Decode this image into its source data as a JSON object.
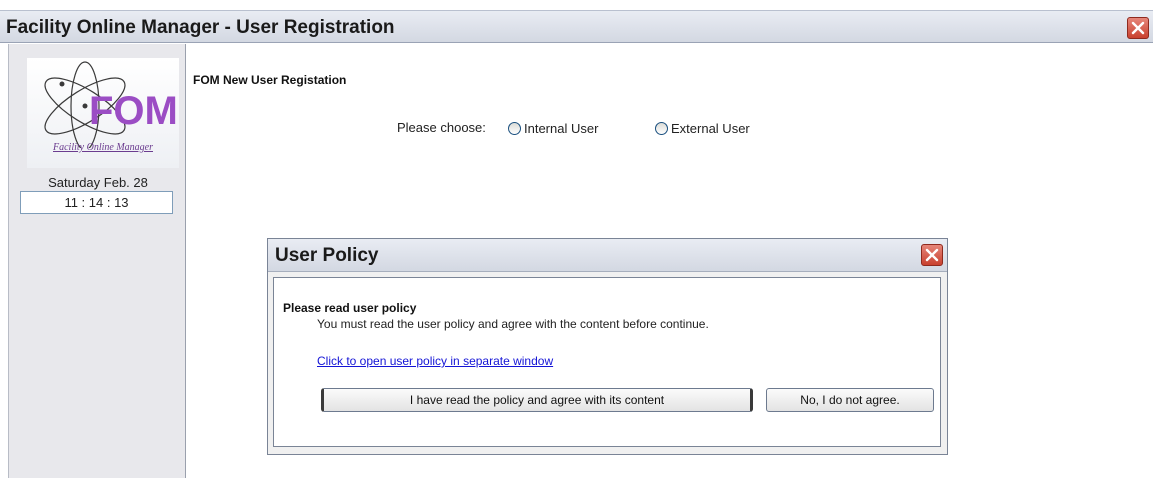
{
  "window": {
    "title": "Facility Online Manager - User Registration"
  },
  "sidebar": {
    "logo_letters": "FOM",
    "logo_caption": "Facility Online Manager",
    "date": "Saturday Feb. 28",
    "time": "11 : 14 : 13"
  },
  "main": {
    "title": "FOM New User Registation",
    "choose_label": "Please choose:",
    "options": [
      {
        "label": "Internal User",
        "selected": false
      },
      {
        "label": "External User",
        "selected": false
      }
    ]
  },
  "dialog": {
    "title": "User Policy",
    "heading": "Please read user policy",
    "text": "You must read the user policy and agree with the content before continue.",
    "link": "Click to open user policy in separate window",
    "agree_button": "I have read the policy and agree with its content",
    "disagree_button": "No, I do not agree."
  },
  "colors": {
    "logo_purple": "#8e44b5",
    "link_blue": "#1414d6",
    "close_red": "#c9412f"
  },
  "icons": {
    "close": "close-icon",
    "radio": "radio-icon",
    "logo": "atom-logo-icon"
  }
}
